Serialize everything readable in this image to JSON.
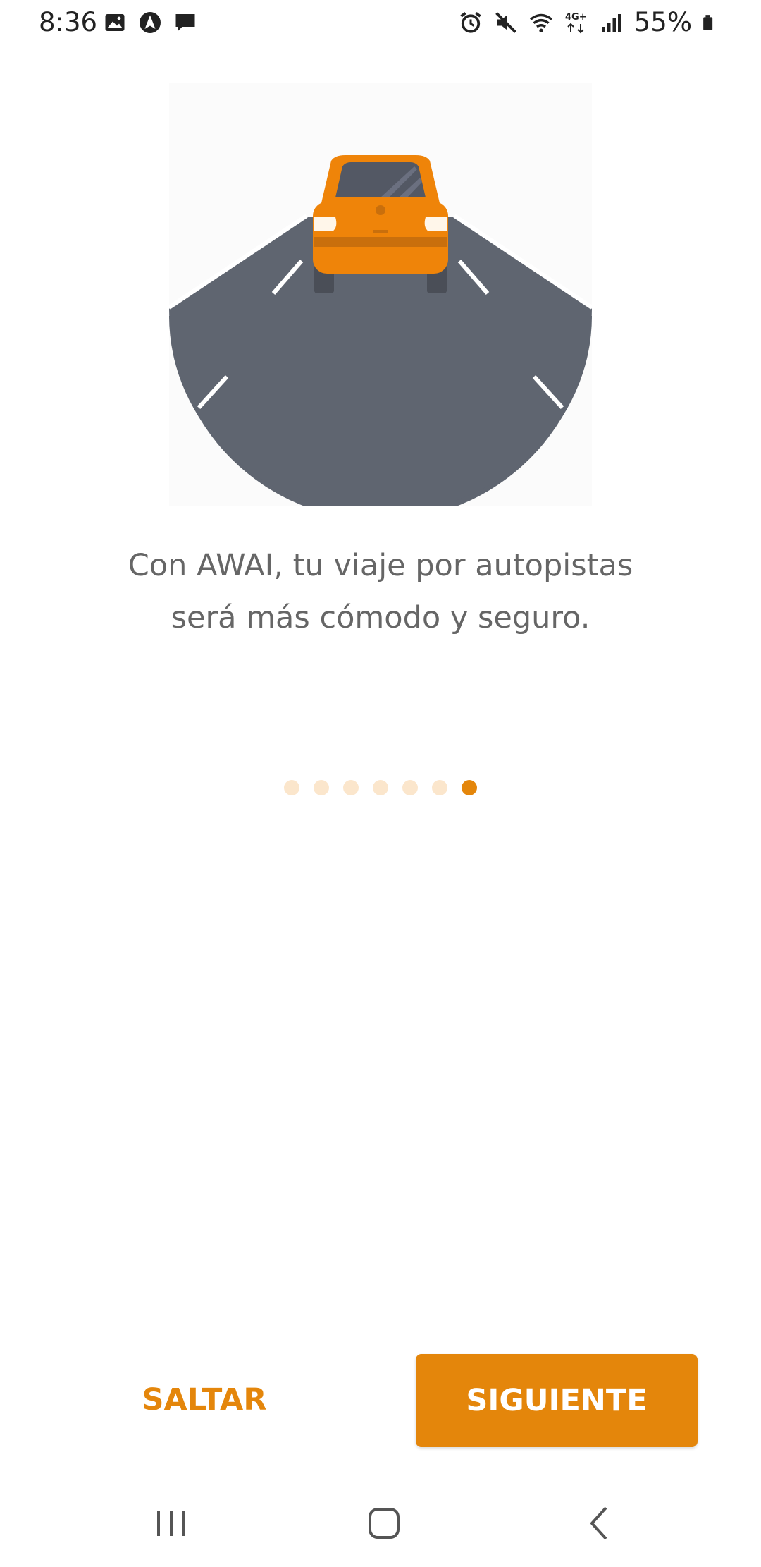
{
  "status_bar": {
    "time": "8:36",
    "left_icons": [
      "image-icon",
      "navigation-app-icon",
      "message-icon"
    ],
    "right_icons": [
      "alarm-icon",
      "mute-icon",
      "wifi-icon",
      "network-4g-icon",
      "signal-icon",
      "battery-icon"
    ],
    "network_label": "4G+",
    "battery_percent": "55%"
  },
  "onboarding": {
    "illustration": "car-on-highway-illustration",
    "message_line1": "Con AWAI, tu viaje por autopistas",
    "message_line2": "será más cómodo y seguro.",
    "pager": {
      "total_pages": 7,
      "current_page": 7
    }
  },
  "actions": {
    "skip_label": "SALTAR",
    "next_label": "SIGUIENTE"
  },
  "navigation_bar": {
    "items": [
      "recents-icon",
      "home-icon",
      "back-icon"
    ]
  },
  "colors": {
    "accent": "#e4860b",
    "dot_inactive": "#fbe6cc",
    "road": "#5f6570",
    "text": "#666666"
  }
}
